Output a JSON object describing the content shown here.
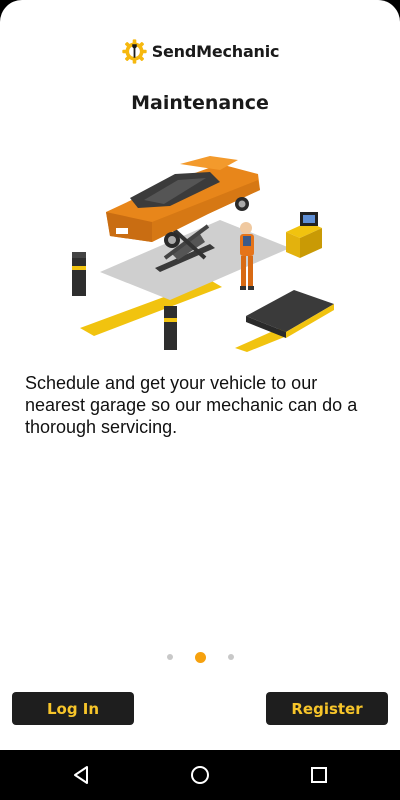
{
  "app": {
    "brand_name": "SendMechanic",
    "brand_color": "#f6b80e"
  },
  "onboarding": {
    "title": "Maintenance",
    "description": "Schedule and get your vehicle to our nearest garage so our mechanic can do a thorough servicing.",
    "illustration": "car-on-lift-with-mechanic",
    "pager": {
      "total": 3,
      "active_index": 1
    }
  },
  "actions": {
    "login_label": "Log In",
    "register_label": "Register"
  },
  "system_nav": {
    "items": [
      "back-icon",
      "home-icon",
      "recents-icon"
    ]
  },
  "colors": {
    "accent": "#f6a10e",
    "button_bg": "#1e1e1e",
    "button_text": "#f7c52a"
  }
}
